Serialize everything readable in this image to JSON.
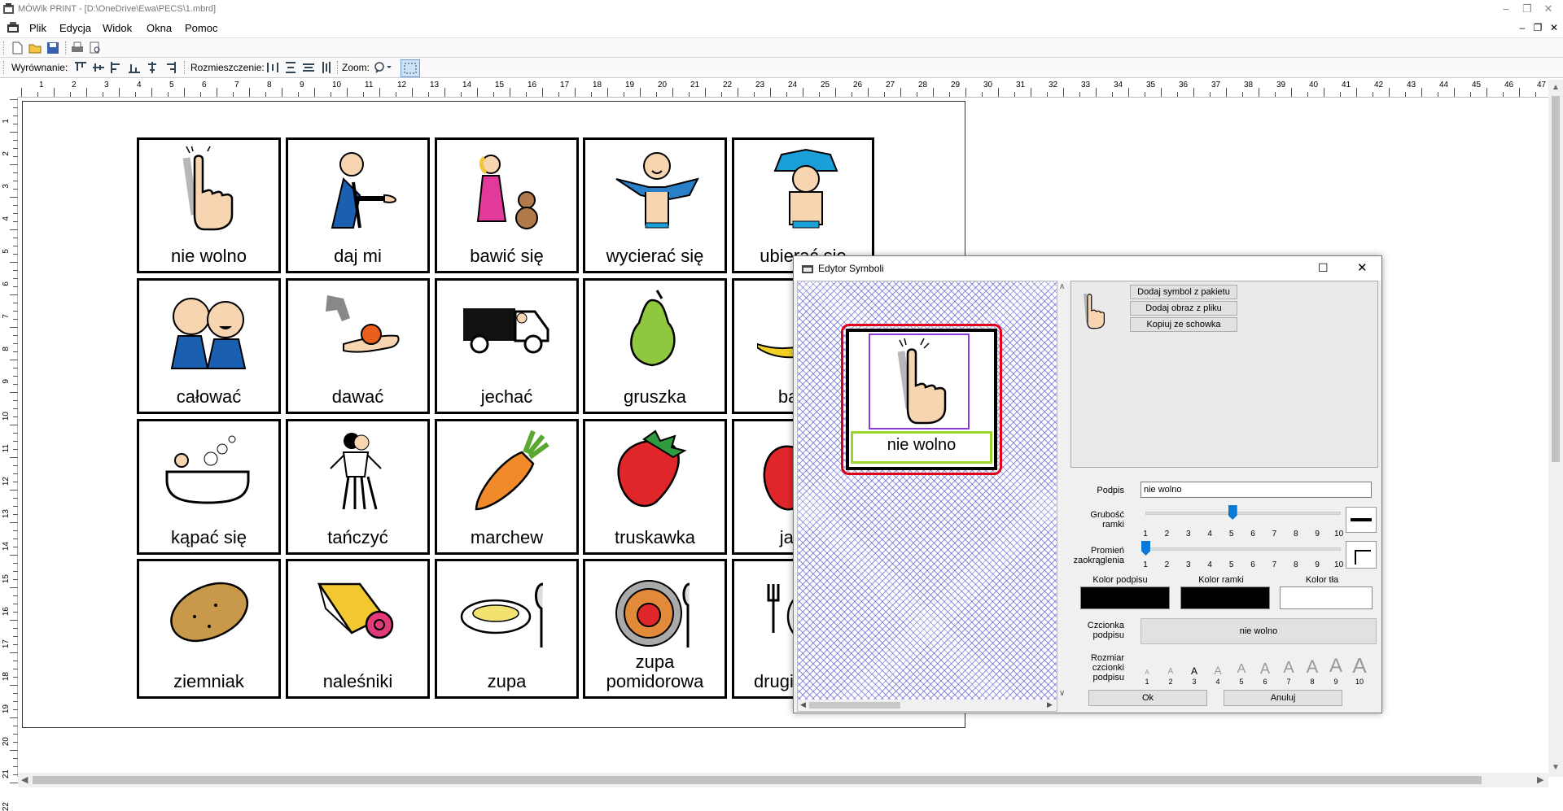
{
  "window": {
    "title": "MÓWik PRINT - [D:\\OneDrive\\Ewa\\PECS\\1.mbrd]"
  },
  "menu": [
    "Plik",
    "Edycja",
    "Widok",
    "Okna",
    "Pomoc"
  ],
  "toolbar2": {
    "align_label": "Wyrównanie:",
    "distribute_label": "Rozmieszczenie:",
    "zoom_label": "Zoom:"
  },
  "ruler_h": [
    "1",
    "2",
    "3",
    "4",
    "5",
    "6",
    "7",
    "8",
    "9",
    "10",
    "11",
    "12",
    "13",
    "14",
    "15",
    "16",
    "17",
    "18",
    "19",
    "20",
    "21",
    "22",
    "23",
    "24",
    "25",
    "26",
    "27",
    "28",
    "29",
    "30",
    "31",
    "32",
    "33",
    "34",
    "35",
    "36",
    "37",
    "38",
    "39",
    "40",
    "41",
    "42",
    "43",
    "44",
    "45",
    "46",
    "47"
  ],
  "ruler_v": [
    "1",
    "2",
    "3",
    "4",
    "5",
    "6",
    "7",
    "8",
    "9",
    "10",
    "11",
    "12",
    "13",
    "14",
    "15",
    "16",
    "17",
    "18",
    "19",
    "20",
    "21",
    "22"
  ],
  "cards": [
    {
      "label": "nie wolno",
      "icon": "no-finger-icon"
    },
    {
      "label": "daj mi",
      "icon": "give-me-icon"
    },
    {
      "label": "bawić się",
      "icon": "play-icon"
    },
    {
      "label": "wycierać się",
      "icon": "towel-icon"
    },
    {
      "label": "ubierać się",
      "icon": "dress-icon"
    },
    {
      "label": "całować",
      "icon": "kiss-icon"
    },
    {
      "label": "dawać",
      "icon": "give-icon"
    },
    {
      "label": "jechać",
      "icon": "van-icon"
    },
    {
      "label": "gruszka",
      "icon": "pear-icon"
    },
    {
      "label": "banan",
      "icon": "banana-icon"
    },
    {
      "label": "kąpać się",
      "icon": "bath-icon"
    },
    {
      "label": "tańczyć",
      "icon": "dance-icon"
    },
    {
      "label": "marchew",
      "icon": "carrot-icon"
    },
    {
      "label": "truskawka",
      "icon": "strawberry-icon"
    },
    {
      "label": "jabłko",
      "icon": "apple-icon"
    },
    {
      "label": "ziemniak",
      "icon": "potato-icon"
    },
    {
      "label": "naleśniki",
      "icon": "pancakes-icon"
    },
    {
      "label": "zupa",
      "icon": "soup-icon"
    },
    {
      "label": "zupa pomidorowa",
      "icon": "tomato-soup-icon"
    },
    {
      "label": "drugie danie",
      "icon": "main-course-icon"
    }
  ],
  "dialog": {
    "title": "Edytor Symboli",
    "preview_caption": "nie wolno",
    "btn_add_pack": "Dodaj symbol z pakietu",
    "btn_add_file": "Dodaj obraz z pliku",
    "btn_paste": "Kopiuj ze schowka",
    "caption_label": "Podpis",
    "caption_value": "nie wolno",
    "thickness_label": "Grubość ramki",
    "thickness_value": 5,
    "radius_label": "Promień zaokrąglenia",
    "radius_value": 1,
    "scale": [
      "1",
      "2",
      "3",
      "4",
      "5",
      "6",
      "7",
      "8",
      "9",
      "10"
    ],
    "color_caption_label": "Kolor podpisu",
    "color_frame_label": "Kolor ramki",
    "color_bg_label": "Kolor tła",
    "colors": {
      "caption": "#000000",
      "frame": "#000000",
      "background": "#ffffff"
    },
    "font_label": "Czcionka podpisu",
    "font_sample": "nie wolno",
    "font_size_label": "Rozmiar czcionki podpisu",
    "font_size_glyph": "A",
    "ok_label": "Ok",
    "cancel_label": "Anuluj"
  }
}
